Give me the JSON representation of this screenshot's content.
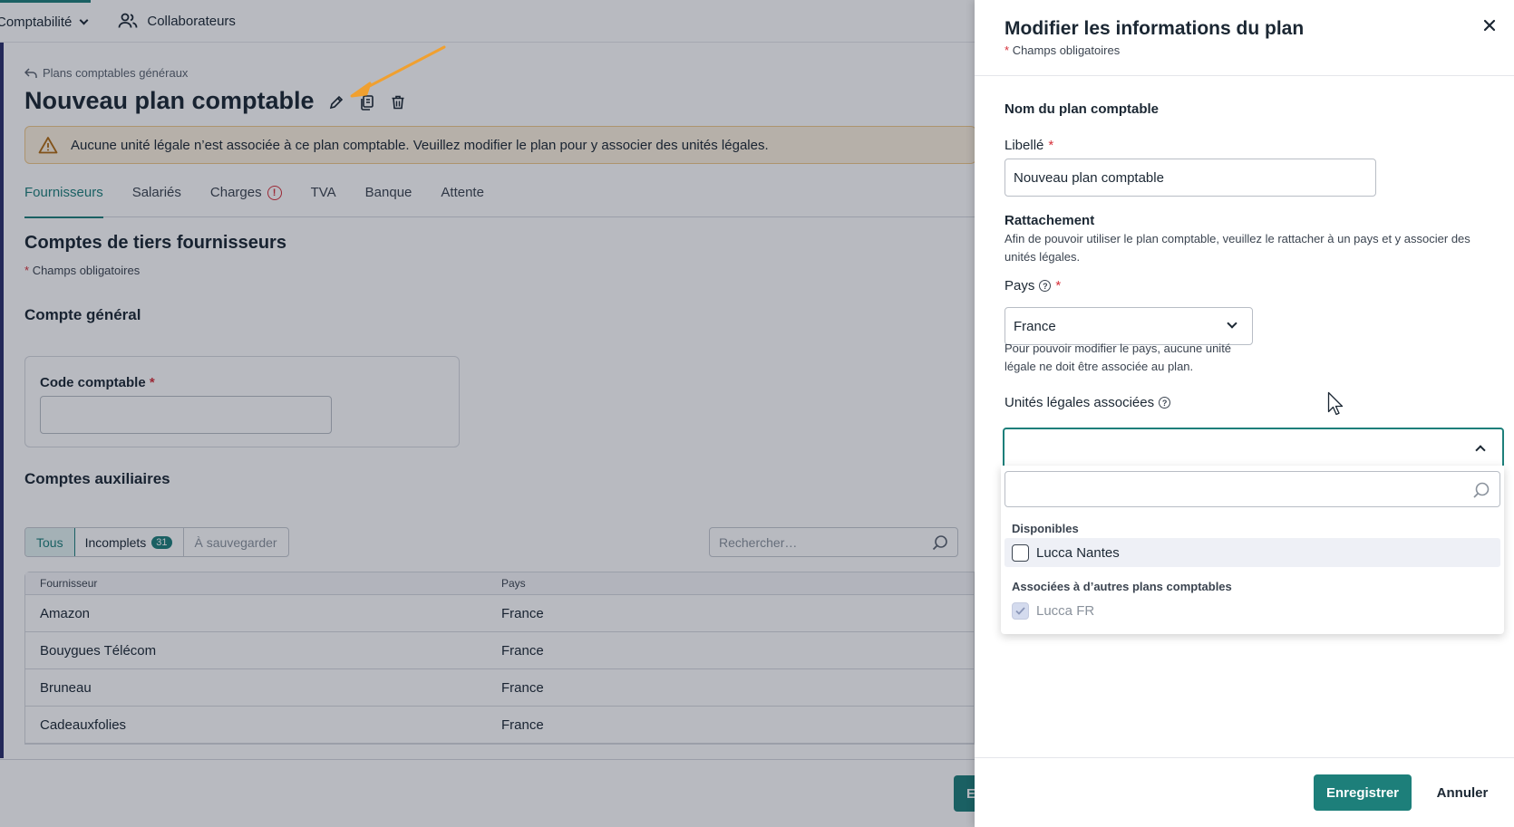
{
  "nav": {
    "accounting_label": "Comptabilité",
    "collaborators_label": "Collaborateurs"
  },
  "page": {
    "breadcrumb": "Plans comptables généraux",
    "title": "Nouveau plan comptable",
    "alert": "Aucune unité légale n’est associée à ce plan comptable. Veuillez modifier le plan pour y associer des unités légales.",
    "tabs": [
      {
        "label": "Fournisseurs"
      },
      {
        "label": "Salariés"
      },
      {
        "label": "Charges"
      },
      {
        "label": "TVA"
      },
      {
        "label": "Banque"
      },
      {
        "label": "Attente"
      }
    ],
    "section_title": "Comptes de tiers fournisseurs",
    "required_note": "Champs obligatoires",
    "general_account_title": "Compte général",
    "code_label": "Code comptable",
    "auxiliary_title": "Comptes auxiliaires",
    "filters": {
      "all": "Tous",
      "incomplete": "Incomplets",
      "incomplete_count": "31",
      "to_save": "À sauvegarder"
    },
    "search_placeholder": "Rechercher…",
    "table": {
      "col_supplier": "Fournisseur",
      "col_country": "Pays",
      "rows": [
        {
          "supplier": "Amazon",
          "country": "France"
        },
        {
          "supplier": "Bouygues Télécom",
          "country": "France"
        },
        {
          "supplier": "Bruneau",
          "country": "France"
        },
        {
          "supplier": "Cadeauxfolies",
          "country": "France"
        }
      ]
    },
    "bottom_save_stub": "E"
  },
  "panel": {
    "title": "Modifier les informations du plan",
    "required_note": "Champs obligatoires",
    "name_section": "Nom du plan comptable",
    "label_field": "Libellé",
    "label_value": "Nouveau plan comptable",
    "attachment_title": "Rattachement",
    "attachment_help": "Afin de pouvoir utiliser le plan comptable, veuillez le rattacher à un pays et y associer des unités légales.",
    "country_label": "Pays",
    "country_value": "France",
    "country_help": "Pour pouvoir modifier le pays, aucune unité légale ne doit être associée au plan.",
    "units_label": "Unités légales associées",
    "dropdown": {
      "group_available": "Disponibles",
      "available": [
        {
          "label": "Lucca Nantes",
          "checked": false
        }
      ],
      "group_other": "Associées à d’autres plans comptables",
      "other": [
        {
          "label": "Lucca FR",
          "checked": true
        }
      ]
    },
    "save_label": "Enregistrer",
    "cancel_label": "Annuler"
  },
  "colors": {
    "accent": "#1d7f7a",
    "required": "#d6303a",
    "warning_bg": "#fdf1de",
    "annotation_arrow": "#f0a030"
  }
}
